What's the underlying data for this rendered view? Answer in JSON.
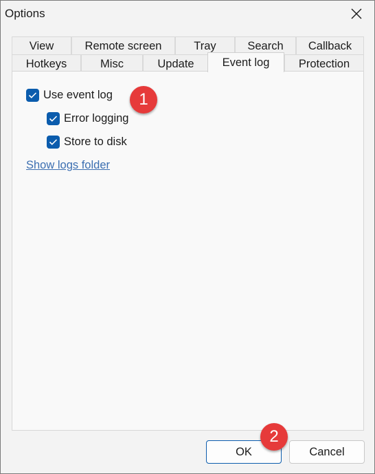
{
  "window": {
    "title": "Options"
  },
  "tabs_row_back": [
    {
      "label": "View"
    },
    {
      "label": "Remote screen"
    },
    {
      "label": "Tray"
    },
    {
      "label": "Search"
    },
    {
      "label": "Callback"
    }
  ],
  "tabs_row_front": [
    {
      "label": "Hotkeys"
    },
    {
      "label": "Misc"
    },
    {
      "label": "Update"
    },
    {
      "label": "Event log",
      "active": true
    },
    {
      "label": "Protection"
    }
  ],
  "event_log": {
    "use_event_log": {
      "label": "Use event log",
      "checked": true
    },
    "error_logging": {
      "label": "Error logging",
      "checked": true
    },
    "store_to_disk": {
      "label": "Store to disk",
      "checked": true
    },
    "show_logs_folder": "Show logs folder"
  },
  "buttons": {
    "ok": "OK",
    "cancel": "Cancel"
  },
  "annotations": {
    "marker_1": "1",
    "marker_2": "2"
  },
  "colors": {
    "accent": "#0b5cad",
    "link": "#3c6fb1",
    "marker": "#e63a3a",
    "window_bg": "#f3f3f3",
    "panel_bg": "#f9f9f9"
  }
}
